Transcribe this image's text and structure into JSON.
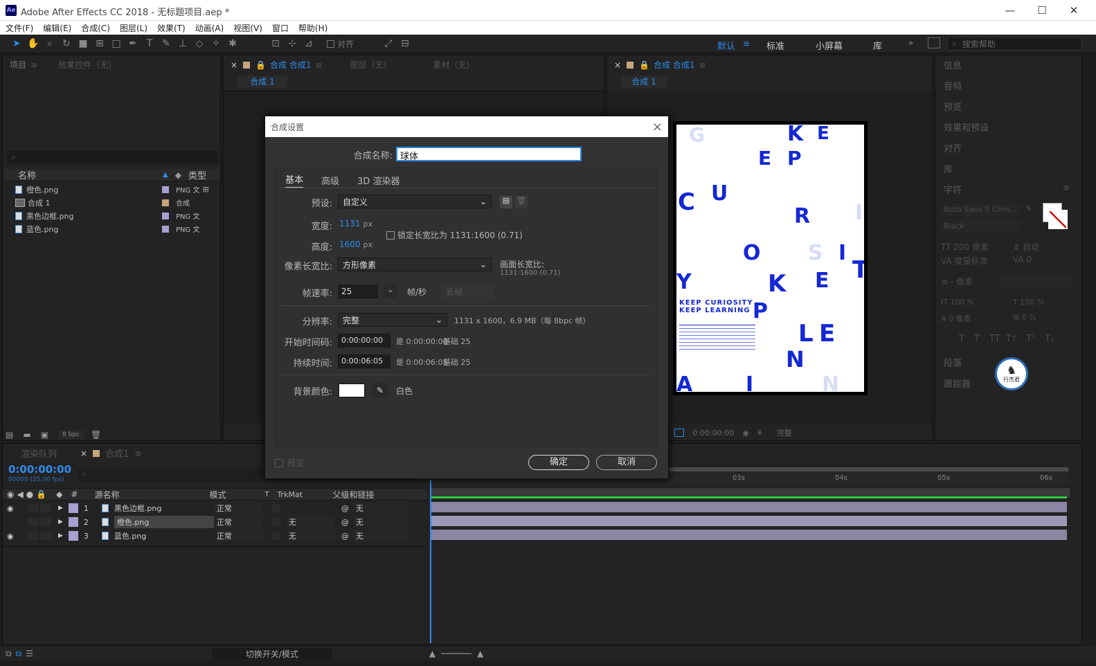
{
  "window": {
    "logo": "Ae",
    "title": "Adobe After Effects CC 2018 - 无标题项目.aep *"
  },
  "menu": [
    "文件(F)",
    "编辑(E)",
    "合成(C)",
    "图层(L)",
    "效果(T)",
    "动画(A)",
    "视图(V)",
    "窗口",
    "帮助(H)"
  ],
  "toolbar": {
    "align_label": "对齐"
  },
  "workspaces": [
    "默认",
    "标准",
    "小屏幕",
    "库"
  ],
  "search_help": "搜索帮助",
  "project_panel": {
    "tab_project": "项目",
    "tab_effects": "效果控件（无）",
    "col_name": "名称",
    "col_type": "类型",
    "items": [
      {
        "name": "橙色.png",
        "type": "PNG 文",
        "color": "#a8a0d0"
      },
      {
        "name": "合成 1",
        "type": "合成",
        "color": "#c4a57c"
      },
      {
        "name": "黑色边框.png",
        "type": "PNG 文",
        "color": "#a8a0d0"
      },
      {
        "name": "蓝色.png",
        "type": "PNG 文",
        "color": "#a8a0d0"
      }
    ],
    "bpc": "8 bpc"
  },
  "comp_panel_left": {
    "tab": "合成 合成1",
    "tab2": "图层（无）",
    "tab3": "素材（无）",
    "sub": "合成 1"
  },
  "comp_panel_right": {
    "tab": "合成 合成1",
    "sub": "合成 1",
    "timecode": "0:00:00:00",
    "resolution": "完整"
  },
  "right_panel": {
    "items": [
      "信息",
      "音频",
      "预览",
      "效果和预设",
      "对齐",
      "库",
      "字符",
      "段落",
      "跟踪器"
    ],
    "font": "Noto Sans S Chin...",
    "style": "Black",
    "size": "200 像素",
    "leading": "自动",
    "kerning": "度量标准",
    "tracking": "0",
    "stroke": "- 像素",
    "vscale": "100 %",
    "hscale": "100 %",
    "baseline": "0 像素",
    "tsume": "0 %",
    "type_buttons": [
      "T",
      "T",
      "TT",
      "Tт",
      "T¹",
      "T₁"
    ]
  },
  "dialog": {
    "title": "合成设置",
    "comp_name_label": "合成名称:",
    "comp_name": "球体",
    "tabs": [
      "基本",
      "高级",
      "3D 渲染器"
    ],
    "preset_label": "预设:",
    "preset": "自定义",
    "width_label": "宽度:",
    "width": "1131",
    "height_label": "高度:",
    "height": "1600",
    "px": "px",
    "lock_label": "锁定长宽比为 1131:1600 (0.71)",
    "par_label": "像素长宽比:",
    "par": "方形像素",
    "frame_aspect_label": "画面长宽比:",
    "frame_aspect": "1131:1600 (0.71)",
    "fps_label": "帧速率:",
    "fps": "25",
    "fps_unit": "帧/秒",
    "drop": "丢帧",
    "res_label": "分辨率:",
    "res": "完整",
    "res_info": "1131 x 1600，6.9 MB（每 8bpc 帧）",
    "start_label": "开始时间码:",
    "start": "0:00:00:00",
    "start_info": "是 0:00:00:00",
    "base_label": "基础 25",
    "dur_label": "持续时间:",
    "dur": "0:00:06:05",
    "dur_info": "是 0:00:06:05",
    "bg_label": "背景颜色:",
    "bg_name": "白色",
    "preview": "预览",
    "ok": "确定",
    "cancel": "取消"
  },
  "timeline": {
    "tab_render": "渲染队列",
    "tab_comp": "合成1",
    "timecode": "0:00:00:00",
    "fps": "00000 (25.00 fps)",
    "cols": {
      "name": "源名称",
      "mode": "模式",
      "t": "T",
      "trk": "TrkMat",
      "parent": "父级和链接"
    },
    "ruler": [
      "03s",
      "04s",
      "05s",
      "06s"
    ],
    "layers": [
      {
        "num": "1",
        "name": "黑色边框.png",
        "mode": "正常",
        "trk": "",
        "parent": "无"
      },
      {
        "num": "2",
        "name": "橙色.png",
        "mode": "正常",
        "trk": "无",
        "parent": "无"
      },
      {
        "num": "3",
        "name": "蓝色.png",
        "mode": "正常",
        "trk": "无",
        "parent": "无"
      }
    ],
    "toggle": "切换开关/模式"
  },
  "poster": {
    "letters": [
      "G",
      "K",
      "E",
      "E",
      "P",
      "C",
      "U",
      "R",
      "O",
      "S",
      "I",
      "T",
      "Y",
      "K",
      "E",
      "P",
      "L",
      "E",
      "N",
      "A",
      "I",
      "N",
      "I"
    ],
    "headline1": "KEEP CURIOSITY",
    "headline2": "KEEP LEARNING"
  },
  "badge": "行杰君"
}
